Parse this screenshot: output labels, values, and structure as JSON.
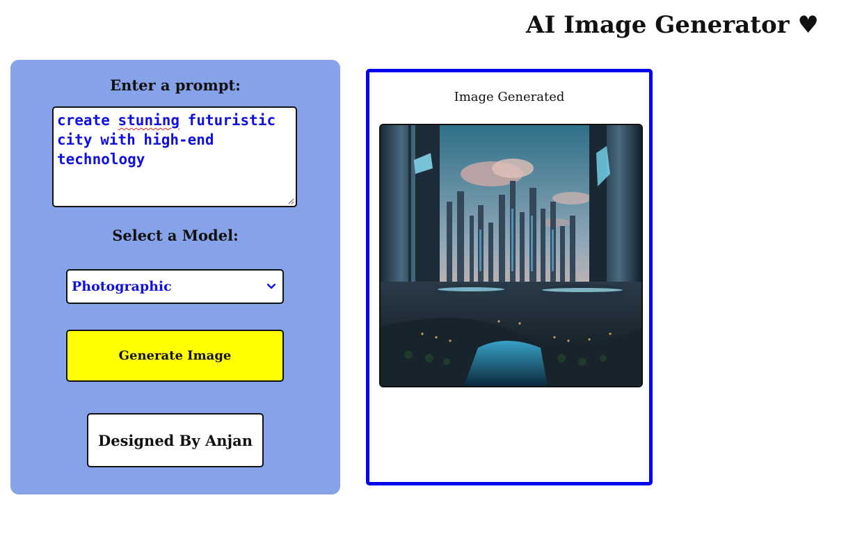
{
  "header": {
    "title": "AI Image Generator ♥"
  },
  "form": {
    "prompt_heading": "Enter a prompt:",
    "prompt_value_plain": "create ",
    "prompt_value_misspelled": "stuning",
    "prompt_value_rest": " futuristic city with high-end technology",
    "model_heading": "Select a Model:",
    "model_selected": "Photographic",
    "generate_label": "Generate Image",
    "credit": "Designed By Anjan"
  },
  "result": {
    "title": "Image Generated",
    "image_subject": "futuristic city"
  },
  "colors": {
    "panel_bg": "#86a2e8",
    "button_bg": "#ffff00",
    "input_text": "#1010e0",
    "card_border": "#0000ee"
  },
  "icons": {
    "select_chevron": "chevron-down-icon",
    "textarea_resize": "resize-handle-icon"
  }
}
